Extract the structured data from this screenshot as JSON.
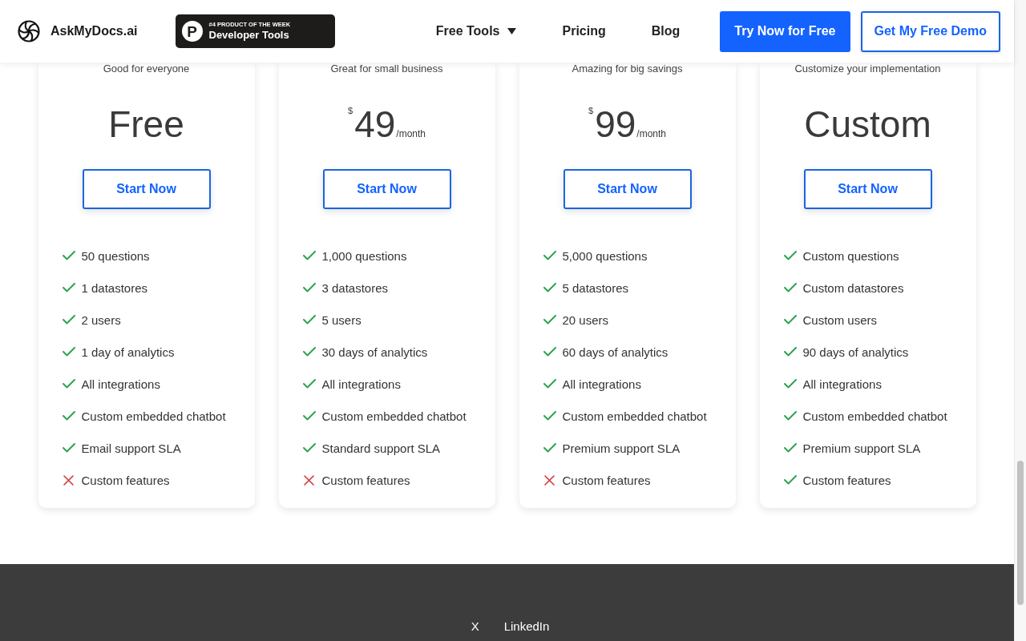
{
  "header": {
    "logo": "AskMyDocs.ai",
    "badge": {
      "icon_letter": "P",
      "eyebrow": "#4 PRODUCT OF THE WEEK",
      "title": "Developer Tools"
    },
    "nav": [
      {
        "label": "Free Tools",
        "dropdown": true
      },
      {
        "label": "Pricing",
        "dropdown": false
      },
      {
        "label": "Blog",
        "dropdown": false
      }
    ],
    "buttons": [
      {
        "label": "Try Now for Free",
        "kind": "primary"
      },
      {
        "label": "Get My Free Demo",
        "kind": "outline"
      }
    ]
  },
  "plans": [
    {
      "tagline": "Good for everyone",
      "price": {
        "kind": "text",
        "amount": "Free"
      },
      "button": "Start Now",
      "features": [
        {
          "label": "50 questions",
          "included": true
        },
        {
          "label": "1 datastores",
          "included": true
        },
        {
          "label": "2 users",
          "included": true
        },
        {
          "label": "1 day of analytics",
          "included": true
        },
        {
          "label": "All integrations",
          "included": true
        },
        {
          "label": "Custom embedded chatbot",
          "included": true
        },
        {
          "label": "Email support SLA",
          "included": true
        },
        {
          "label": "Custom features",
          "included": false
        }
      ]
    },
    {
      "tagline": "Great for small business",
      "price": {
        "kind": "monthly",
        "currency": "$",
        "amount": "49",
        "period": "/month"
      },
      "button": "Start Now",
      "features": [
        {
          "label": "1,000 questions",
          "included": true
        },
        {
          "label": "3 datastores",
          "included": true
        },
        {
          "label": "5 users",
          "included": true
        },
        {
          "label": "30 days of analytics",
          "included": true
        },
        {
          "label": "All integrations",
          "included": true
        },
        {
          "label": "Custom embedded chatbot",
          "included": true
        },
        {
          "label": "Standard support SLA",
          "included": true
        },
        {
          "label": "Custom features",
          "included": false
        }
      ]
    },
    {
      "tagline": "Amazing for big savings",
      "price": {
        "kind": "monthly",
        "currency": "$",
        "amount": "99",
        "period": "/month"
      },
      "button": "Start Now",
      "features": [
        {
          "label": "5,000 questions",
          "included": true
        },
        {
          "label": "5 datastores",
          "included": true
        },
        {
          "label": "20 users",
          "included": true
        },
        {
          "label": "60 days of analytics",
          "included": true
        },
        {
          "label": "All integrations",
          "included": true
        },
        {
          "label": "Custom embedded chatbot",
          "included": true
        },
        {
          "label": "Premium support SLA",
          "included": true
        },
        {
          "label": "Custom features",
          "included": false
        }
      ]
    },
    {
      "tagline": "Customize your implementation",
      "price": {
        "kind": "text",
        "amount": "Custom"
      },
      "button": "Start Now",
      "features": [
        {
          "label": "Custom questions",
          "included": true
        },
        {
          "label": "Custom datastores",
          "included": true
        },
        {
          "label": "Custom users",
          "included": true
        },
        {
          "label": "90 days of analytics",
          "included": true
        },
        {
          "label": "All integrations",
          "included": true
        },
        {
          "label": "Custom embedded chatbot",
          "included": true
        },
        {
          "label": "Premium support SLA",
          "included": true
        },
        {
          "label": "Custom features",
          "included": true
        }
      ]
    }
  ],
  "footer": {
    "links": [
      "X",
      "LinkedIn"
    ]
  }
}
